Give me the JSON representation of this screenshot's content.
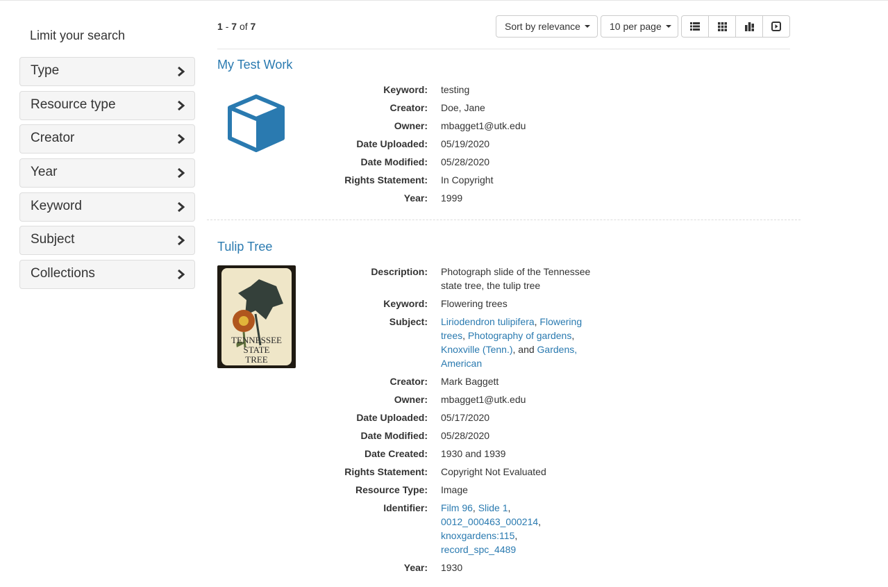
{
  "sidebar": {
    "heading": "Limit your search",
    "facets": [
      {
        "label": "Type"
      },
      {
        "label": "Resource type"
      },
      {
        "label": "Creator"
      },
      {
        "label": "Year"
      },
      {
        "label": "Keyword"
      },
      {
        "label": "Subject"
      },
      {
        "label": "Collections"
      }
    ]
  },
  "results_header": {
    "start": "1",
    "sep": "-",
    "end": "7",
    "of": "of",
    "total": "7",
    "sort_label": "Sort by relevance",
    "per_page_label": "10 per page",
    "views": [
      "List",
      "Gallery",
      "Masonry",
      "Slideshow"
    ]
  },
  "documents": [
    {
      "title": "My Test Work",
      "icon": "cube-icon",
      "fields": [
        {
          "key": "Keyword:",
          "value": "testing"
        },
        {
          "key": "Creator:",
          "value": "Doe, Jane"
        },
        {
          "key": "Owner:",
          "value": "mbagget1@utk.edu"
        },
        {
          "key": "Date Uploaded:",
          "value": "05/19/2020"
        },
        {
          "key": "Date Modified:",
          "value": "05/28/2020"
        },
        {
          "key": "Rights Statement:",
          "value": "In Copyright"
        },
        {
          "key": "Year:",
          "value": "1999"
        }
      ]
    },
    {
      "title": "Tulip Tree",
      "thumb_text": [
        "TENNESSEE",
        "STATE",
        "TREE"
      ],
      "fields": [
        {
          "key": "Description:",
          "value": "Photograph slide of the Tennessee state tree, the tulip tree"
        },
        {
          "key": "Keyword:",
          "value": "Flowering trees"
        },
        {
          "key": "Subject:",
          "links": [
            "Liriodendron tulipifera",
            "Flowering trees",
            "Photography of gardens",
            "Knoxville (Tenn.)",
            "Gardens, American"
          ],
          "conj": ", and "
        },
        {
          "key": "Creator:",
          "value": "Mark Baggett"
        },
        {
          "key": "Owner:",
          "value": "mbagget1@utk.edu"
        },
        {
          "key": "Date Uploaded:",
          "value": "05/17/2020"
        },
        {
          "key": "Date Modified:",
          "value": "05/28/2020"
        },
        {
          "key": "Date Created:",
          "value": "1930 and 1939"
        },
        {
          "key": "Rights Statement:",
          "value": "Copyright Not Evaluated"
        },
        {
          "key": "Resource Type:",
          "value": "Image"
        },
        {
          "key": "Identifier:",
          "links": [
            "Film 96",
            "Slide 1",
            "0012_000463_000214",
            "knoxgardens:115",
            "record_spc_4489"
          ]
        },
        {
          "key": "Year:",
          "value": "1930"
        }
      ]
    }
  ]
}
